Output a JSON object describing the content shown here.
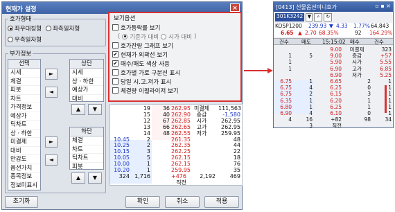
{
  "dialog": {
    "title": "현재가 설정",
    "close": "×"
  },
  "group_type": {
    "legend": "호가형태",
    "options": [
      {
        "label": "좌우대칭형",
        "selected": true
      },
      {
        "label": "좌측일자형",
        "selected": false
      },
      {
        "label": "우측일자형",
        "selected": false
      }
    ]
  },
  "extra_info": {
    "legend": "부가정보",
    "select_list": {
      "header": "선택",
      "items": [
        "시세",
        "체결",
        "피봇",
        "차트",
        "가격정보",
        "예상가",
        "틱차트",
        "상ㆍ하한",
        "미결제",
        "대비",
        "만감도",
        "옵션가치",
        "종목정보",
        "정보미표시"
      ]
    },
    "top_list": {
      "header": "상단",
      "items": [
        "시세",
        "상ㆍ하한",
        "예상가",
        "대비"
      ]
    },
    "bottom_list": {
      "header": "하단",
      "items": [
        "체결",
        "차트",
        "틱차트",
        "피봇"
      ]
    },
    "move_right": "►",
    "move_left": "◄",
    "up": "▲",
    "down": "▼"
  },
  "view_options": {
    "legend": "보기옵션",
    "items": [
      {
        "label": "호가등락률 보기",
        "checked": false
      },
      {
        "label": "호가잔량 그래프 보기",
        "checked": false
      },
      {
        "label": "현재가 외곽선 보기",
        "checked": true
      },
      {
        "label": "매수/매도 색상 사용",
        "checked": true
      },
      {
        "label": "호가별 가로 구분선 표시",
        "checked": false
      },
      {
        "label": "당일 시.고.저가 표시",
        "checked": false
      },
      {
        "label": "체결량 이펄라이저 보기",
        "checked": false
      }
    ],
    "sub_radio": {
      "prefix": "(",
      "a": "기준가 대비",
      "b": "시가 대비",
      "suffix": ")"
    }
  },
  "buttons": {
    "reset": "초기화",
    "ok": "확인",
    "cancel": "취소",
    "apply": "적용"
  },
  "grid": {
    "rows": [
      [
        "",
        "19",
        "36",
        "262.95",
        "미결제",
        "111,563"
      ],
      [
        "",
        "15",
        "40",
        "262.90",
        "증감",
        "-1,580"
      ],
      [
        "",
        "12",
        "67",
        "262.85",
        "시가",
        "262.95"
      ],
      [
        "",
        "13",
        "66",
        "262.65",
        "고가",
        "262.95"
      ],
      [
        "",
        "14",
        "48",
        "262.55",
        "저가",
        "259.95"
      ],
      [
        "10.45",
        "2",
        "",
        "261.35",
        "",
        "48"
      ],
      [
        "10.25",
        "2",
        "",
        "262.35",
        "",
        "44"
      ],
      [
        "10.15",
        "3",
        "",
        "262.25",
        "",
        "22"
      ],
      [
        "10.05",
        "5",
        "",
        "262.15",
        "",
        "18"
      ],
      [
        "10.00",
        "1",
        "",
        "262.15",
        "",
        "76"
      ],
      [
        "10.20",
        "1",
        "",
        "259.95",
        "",
        "35"
      ],
      [
        "324",
        "1,716",
        "",
        "+476",
        "2,192",
        "469"
      ],
      [
        "",
        "",
        "",
        "직전",
        "",
        ""
      ]
    ]
  },
  "target": {
    "title": "[0413] 선물옵션미니호가",
    "code": "301K3242",
    "sub_code": "KOSP1200",
    "price_a": "239.93",
    "chg_a": "▼",
    "diff_a": "4.33",
    "pct_a": "1.77%",
    "vol_a": "64,843",
    "price_b": "6.65",
    "chg_b": "▲",
    "diff_b": "2.70",
    "pct_b": "68.35%",
    "vol_b_pre": "92",
    "vol_b": "164.29%",
    "headers": [
      "건수",
      "매도",
      "15:15:02",
      "매수",
      "건수"
    ],
    "rows": [
      [
        "",
        "",
        "9.00",
        "미결제",
        "323"
      ],
      [
        "1",
        "5",
        "9.00",
        "증감",
        "+57"
      ],
      [
        "1",
        "",
        "5.90",
        "시가",
        "5.55"
      ],
      [
        "1",
        "",
        "6.90",
        "고가",
        "6.85"
      ],
      [
        "",
        "",
        "6.90",
        "저가",
        "5.25"
      ],
      [
        "6.75",
        "1",
        "6.65",
        "2",
        "1"
      ],
      [
        "6.75",
        "4",
        "6.25",
        "0",
        "1"
      ],
      [
        "6.75",
        "2",
        "6.15",
        "3",
        "1"
      ],
      [
        "6.35",
        "1",
        "6.20",
        "1",
        "1"
      ],
      [
        "6.80",
        "1",
        "6.25",
        "1",
        "1"
      ],
      [
        "6.90",
        "4",
        "6.10",
        "0",
        "1"
      ],
      [
        "4",
        "16",
        "+82",
        "98",
        "34"
      ],
      [
        "",
        "3",
        "직전",
        "",
        ""
      ]
    ]
  }
}
